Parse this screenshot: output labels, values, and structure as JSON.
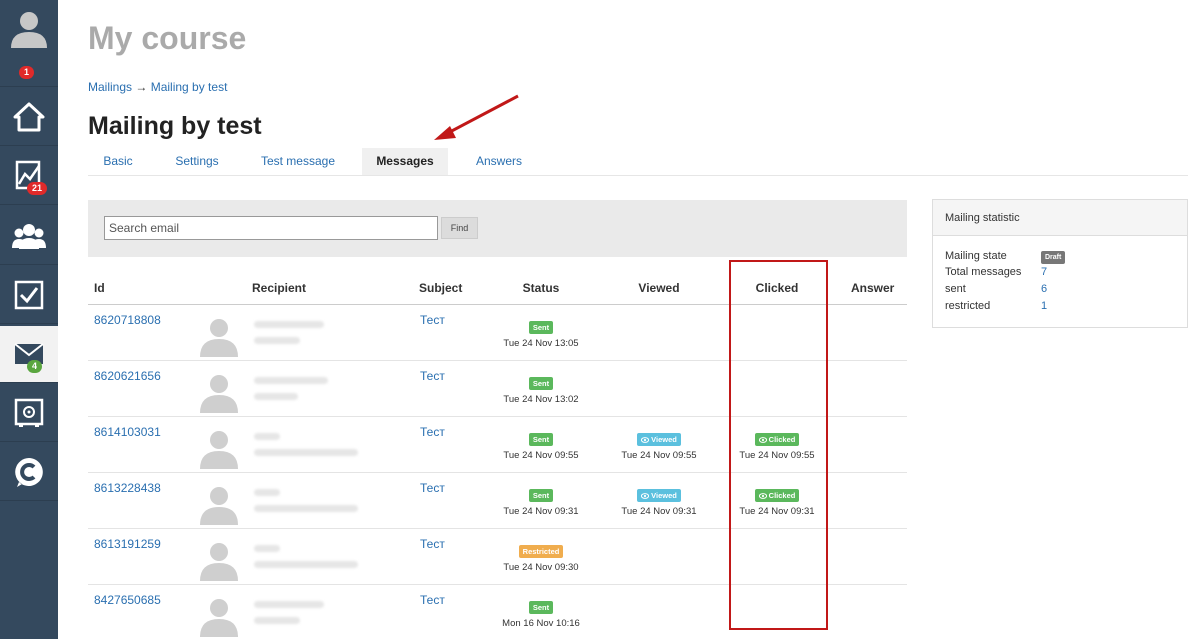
{
  "page": {
    "title": "My course"
  },
  "breadcrumb": {
    "root": "Mailings",
    "separator": "→",
    "current": "Mailing by test"
  },
  "mailing": {
    "title": "Mailing by test"
  },
  "sidebar": {
    "badges": {
      "profile": "1",
      "stats": "21",
      "mail": "4"
    }
  },
  "tabs": [
    {
      "label": "Basic"
    },
    {
      "label": "Settings"
    },
    {
      "label": "Test message"
    },
    {
      "label": "Messages"
    },
    {
      "label": "Answers"
    }
  ],
  "search": {
    "placeholder": "Search email",
    "button": "Find"
  },
  "table": {
    "headers": {
      "id": "Id",
      "recipient": "Recipient",
      "subject": "Subject",
      "status": "Status",
      "viewed": "Viewed",
      "clicked": "Clicked",
      "answer": "Answer"
    },
    "rows": [
      {
        "id": "8620718808",
        "subject": "Тест",
        "status": "Sent",
        "status_date": "Tue 24 Nov 13:05",
        "viewed": "",
        "viewed_date": "",
        "clicked": "",
        "clicked_date": ""
      },
      {
        "id": "8620621656",
        "subject": "Тест",
        "status": "Sent",
        "status_date": "Tue 24 Nov 13:02",
        "viewed": "",
        "viewed_date": "",
        "clicked": "",
        "clicked_date": ""
      },
      {
        "id": "8614103031",
        "subject": "Тест",
        "status": "Sent",
        "status_date": "Tue 24 Nov 09:55",
        "viewed": "Viewed",
        "viewed_date": "Tue 24 Nov 09:55",
        "clicked": "Clicked",
        "clicked_date": "Tue 24 Nov 09:55"
      },
      {
        "id": "8613228438",
        "subject": "Тест",
        "status": "Sent",
        "status_date": "Tue 24 Nov 09:31",
        "viewed": "Viewed",
        "viewed_date": "Tue 24 Nov 09:31",
        "clicked": "Clicked",
        "clicked_date": "Tue 24 Nov 09:31"
      },
      {
        "id": "8613191259",
        "subject": "Тест",
        "status": "Restricted",
        "status_date": "Tue 24 Nov 09:30",
        "viewed": "",
        "viewed_date": "",
        "clicked": "",
        "clicked_date": ""
      },
      {
        "id": "8427650685",
        "subject": "Тест",
        "status": "Sent",
        "status_date": "Mon 16 Nov 10:16",
        "viewed": "",
        "viewed_date": "",
        "clicked": "",
        "clicked_date": ""
      }
    ]
  },
  "statistic": {
    "title": "Mailing statistic",
    "rows": [
      {
        "label": "Mailing state",
        "value": "Draft"
      },
      {
        "label": "Total messages",
        "value": "7"
      },
      {
        "label": "sent",
        "value": "6"
      },
      {
        "label": "restricted",
        "value": "1"
      }
    ]
  },
  "colors": {
    "sidebar": "#34495e",
    "link": "#2a6fb0",
    "sent": "#5bb85c",
    "restricted": "#f0ad4e",
    "viewed": "#5bc0de",
    "annotation": "#c11818"
  }
}
